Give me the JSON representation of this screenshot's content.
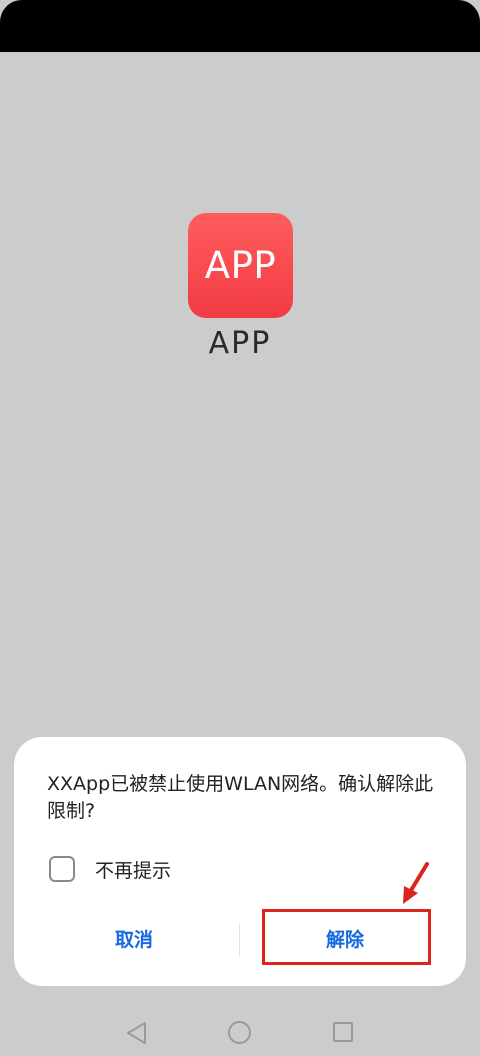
{
  "app": {
    "icon_text": "APP",
    "name": "APP",
    "icon_color": "#f64448"
  },
  "dialog": {
    "message": "XXApp已被禁止使用WLAN网络。确认解除此限制?",
    "checkbox_label": "不再提示",
    "checkbox_checked": false,
    "cancel_label": "取消",
    "confirm_label": "解除",
    "button_color": "#1769e0"
  },
  "annotation": {
    "color": "#d9251c",
    "icon": "arrow-pointer-icon"
  },
  "nav_bar": {
    "back_icon": "triangle-back-icon",
    "home_icon": "circle-home-icon",
    "recents_icon": "square-recents-icon"
  }
}
